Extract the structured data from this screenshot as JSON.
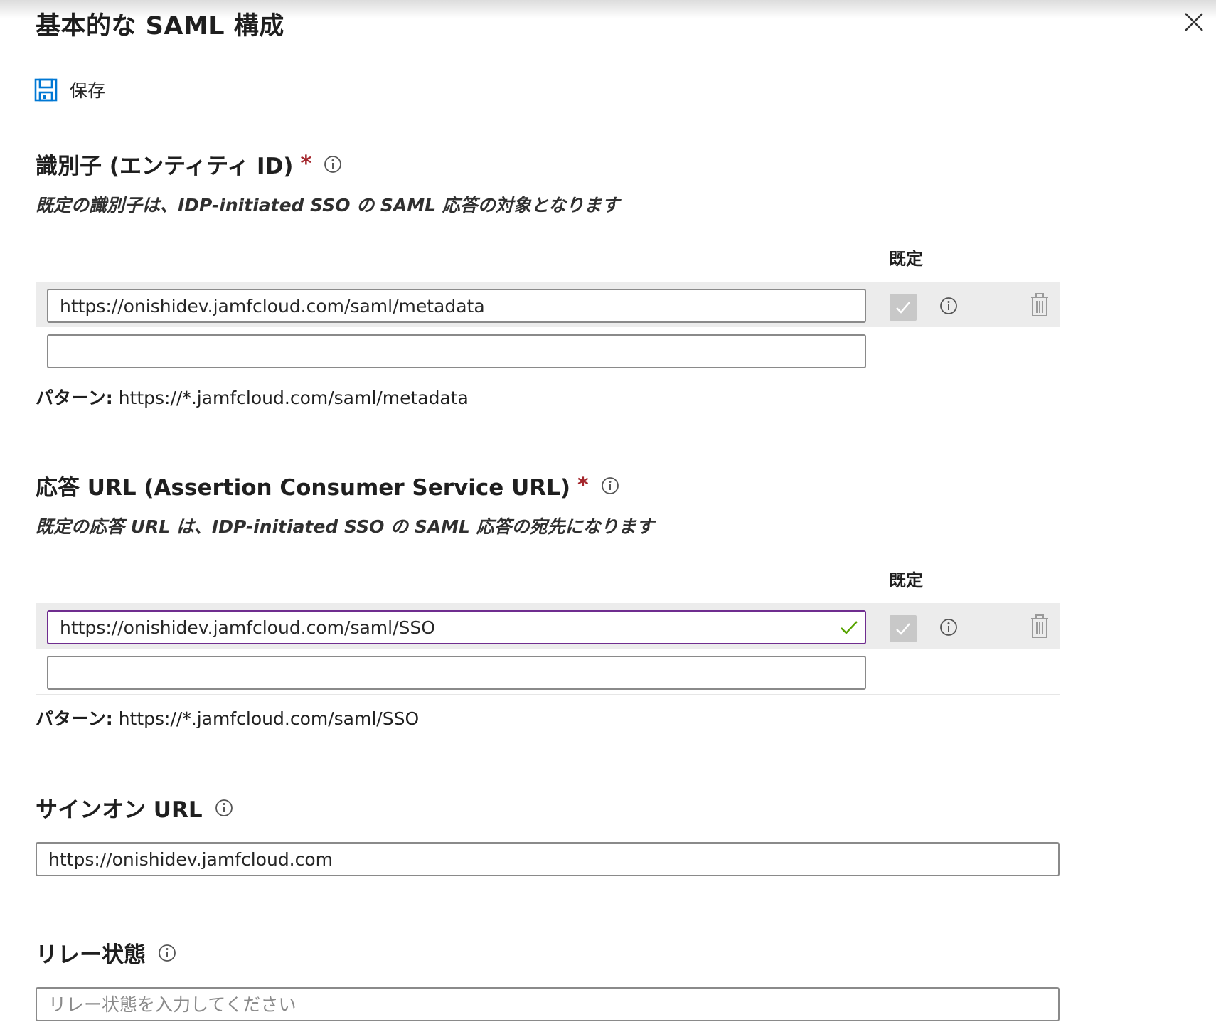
{
  "panel": {
    "title": "基本的な SAML 構成",
    "save_label": "保存"
  },
  "identifier": {
    "heading": "識別子 (エンティティ ID)",
    "required_mark": "*",
    "description": "既定の識別子は、IDP-initiated SSO の SAML 応答の対象となります",
    "default_column": "既定",
    "values": [
      "https://onishidev.jamfcloud.com/saml/metadata",
      ""
    ],
    "pattern_label": "パターン:",
    "pattern_value": "https://*.jamfcloud.com/saml/metadata"
  },
  "reply_url": {
    "heading": "応答 URL (Assertion Consumer Service URL)",
    "required_mark": "*",
    "description": "既定の応答 URL は、IDP-initiated SSO の SAML 応答の宛先になります",
    "default_column": "既定",
    "values": [
      "https://onishidev.jamfcloud.com/saml/SSO",
      ""
    ],
    "pattern_label": "パターン:",
    "pattern_value": "https://*.jamfcloud.com/saml/SSO"
  },
  "sign_on_url": {
    "heading": "サインオン URL",
    "value": "https://onishidev.jamfcloud.com"
  },
  "relay_state": {
    "heading": "リレー状態",
    "placeholder": "リレー状態を入力してください",
    "value": ""
  },
  "colors": {
    "accent_blue": "#0078d4",
    "required_red": "#a4262c",
    "focus_purple": "#6f2d8f",
    "valid_green": "#57a300"
  }
}
